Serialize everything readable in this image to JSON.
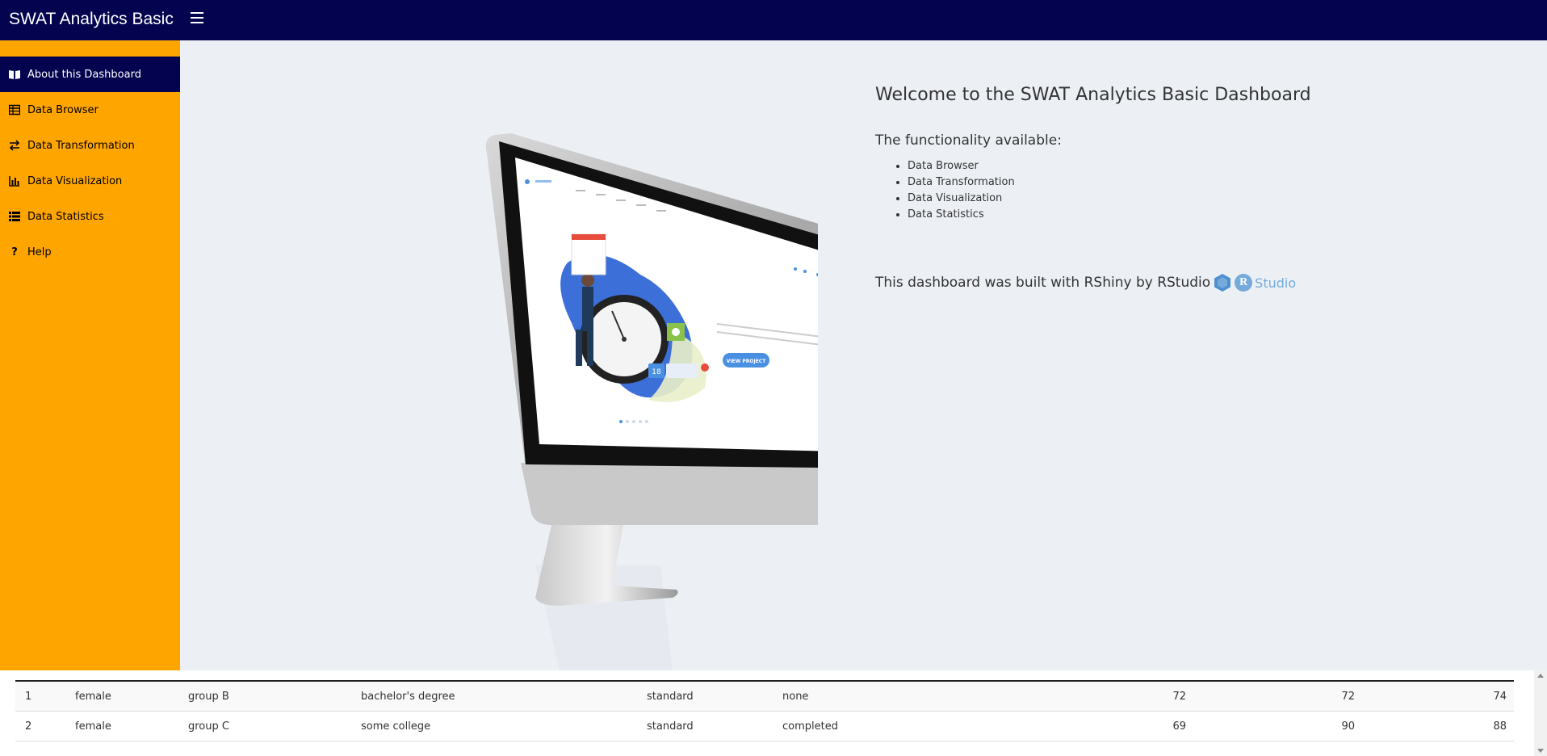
{
  "header": {
    "brand": "SWAT Analytics Basic",
    "menu_icon": "hamburger-icon"
  },
  "sidebar": {
    "items": [
      {
        "label": "About this Dashboard",
        "icon": "book-icon",
        "active": true
      },
      {
        "label": "Data Browser",
        "icon": "table-icon",
        "active": false
      },
      {
        "label": "Data Transformation",
        "icon": "exchange-icon",
        "active": false
      },
      {
        "label": "Data Visualization",
        "icon": "bar-chart-icon",
        "active": false
      },
      {
        "label": "Data Statistics",
        "icon": "list-icon",
        "active": false
      },
      {
        "label": "Help",
        "icon": "question-icon",
        "active": false
      }
    ]
  },
  "main": {
    "title": "Welcome to the SWAT Analytics Basic Dashboard",
    "functionality_heading": "The functionality available:",
    "functionality": [
      "Data Browser",
      "Data Transformation",
      "Data Visualization",
      "Data Statistics"
    ],
    "built_with": "This dashboard was built with RShiny by RStudio",
    "rstudio_logo_r": "R",
    "rstudio_logo_text": "Studio",
    "screen_cta": "VIEW PROJECT",
    "screen_badge": "18"
  },
  "table": {
    "rows": [
      {
        "id": "1",
        "gender": "female",
        "group": "group B",
        "education": "bachelor's degree",
        "lunch": "standard",
        "prep": "none",
        "math": "72",
        "reading": "72",
        "writing": "74"
      },
      {
        "id": "2",
        "gender": "female",
        "group": "group C",
        "education": "some college",
        "lunch": "standard",
        "prep": "completed",
        "math": "69",
        "reading": "90",
        "writing": "88"
      }
    ]
  },
  "colors": {
    "header": "#03034f",
    "sidebar": "#ffa500",
    "content_bg": "#ecf0f5",
    "accent": "#4a90e2"
  }
}
